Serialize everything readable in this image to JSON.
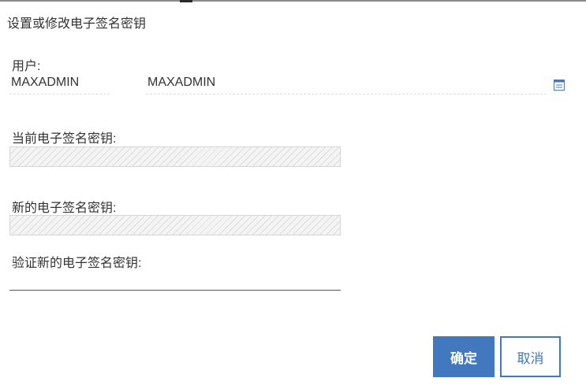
{
  "dialog": {
    "title": "设置或修改电子签名密钥"
  },
  "user": {
    "label": "用户:",
    "id_value": "MAXADMIN",
    "name_value": "MAXADMIN",
    "lookup_icon": "detail-menu-icon"
  },
  "current_key": {
    "label": "当前电子签名密钥:",
    "value": ""
  },
  "new_key": {
    "label": "新的电子签名密钥:",
    "value": ""
  },
  "verify_key": {
    "label": "验证新的电子签名密钥:",
    "value": ""
  },
  "buttons": {
    "ok": "确定",
    "cancel": "取消"
  },
  "colors": {
    "accent": "#4178be",
    "text": "#333333",
    "field_border": "#d6d6d6"
  }
}
